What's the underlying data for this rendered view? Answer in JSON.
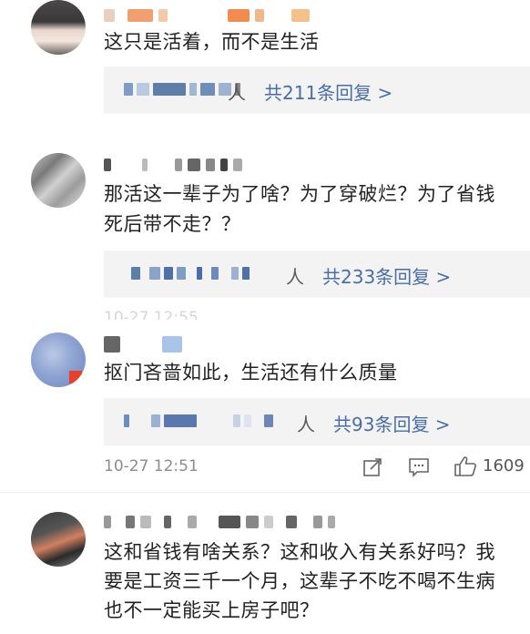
{
  "comments": [
    {
      "text": "这只是活着，而不是生活",
      "reply_people": "人",
      "reply_count": "共211条回复 >"
    },
    {
      "text_line1": "那活这一辈子为了啥？为了穿破烂？为了省钱",
      "text_line2": "死后带不走？？",
      "reply_people": "人",
      "reply_count": "共233条回复 >",
      "timestamp_partial": "10-27 12:55"
    },
    {
      "text": "抠门吝啬如此，生活还有什么质量",
      "reply_people": "人",
      "reply_count": "共93条回复 >",
      "timestamp": "10-27 12:51",
      "likes": "1609"
    },
    {
      "text_line1": "这和省钱有啥关系？这和收入有关系好吗？我",
      "text_line2": "要是工资三千一个月，这辈子不吃不喝不生病",
      "text_line3": "也不一定能买上房子吧？"
    }
  ],
  "icons": {
    "share": "share-icon",
    "comment": "comment-icon",
    "like": "thumb-up-icon"
  },
  "colors": {
    "reply_link": "#4a6da7",
    "reply_bg": "#f3f3f3",
    "timestamp": "#8c8c8c"
  }
}
